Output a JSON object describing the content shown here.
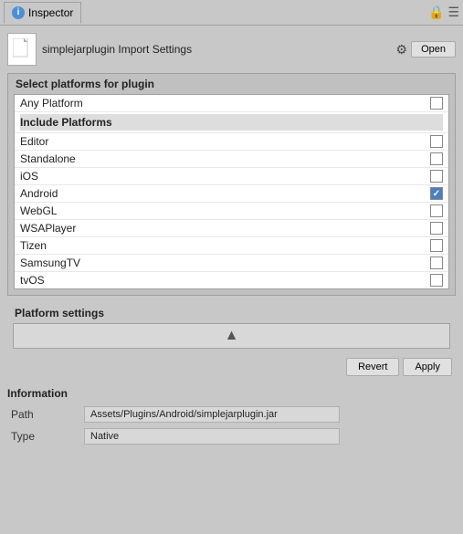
{
  "titleBar": {
    "tabIcon": "i",
    "tabLabel": "Inspector",
    "lockIcon": "🔒",
    "menuIcon": "☰"
  },
  "fileHeader": {
    "fileName": "simplejarplugin Import Settings",
    "gearIcon": "⚙",
    "openButton": "Open"
  },
  "platformSection": {
    "title": "Select platforms for plugin",
    "anyPlatformLabel": "Any Platform",
    "includePlatformsLabel": "Include Platforms",
    "platforms": [
      {
        "name": "Editor",
        "checked": false
      },
      {
        "name": "Standalone",
        "checked": false
      },
      {
        "name": "iOS",
        "checked": false
      },
      {
        "name": "Android",
        "checked": true
      },
      {
        "name": "WebGL",
        "checked": false
      },
      {
        "name": "WSAPlayer",
        "checked": false
      },
      {
        "name": "Tizen",
        "checked": false
      },
      {
        "name": "SamsungTV",
        "checked": false
      },
      {
        "name": "tvOS",
        "checked": false
      }
    ]
  },
  "platformSettings": {
    "title": "Platform settings",
    "androidIcon": "🤖"
  },
  "buttons": {
    "revert": "Revert",
    "apply": "Apply"
  },
  "information": {
    "title": "Information",
    "fields": [
      {
        "label": "Path",
        "value": "Assets/Plugins/Android/simplejarplugin.jar"
      },
      {
        "label": "Type",
        "value": "Native"
      }
    ]
  }
}
